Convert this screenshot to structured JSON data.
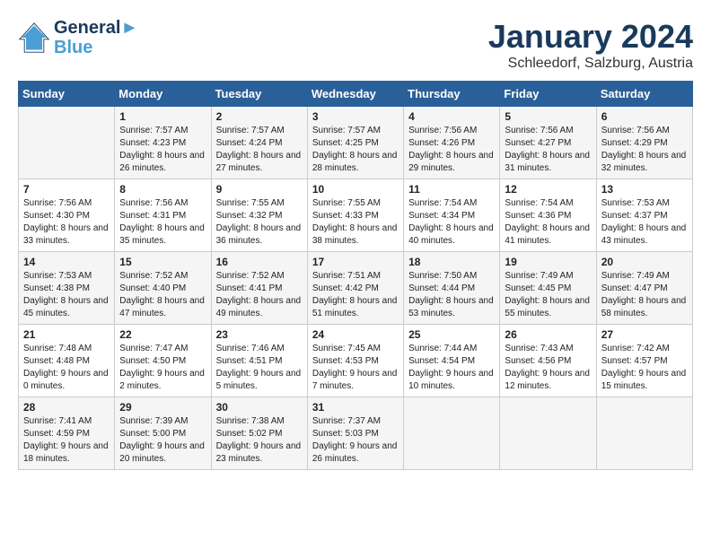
{
  "header": {
    "logo_line1": "General",
    "logo_line2": "Blue",
    "title": "January 2024",
    "subtitle": "Schleedorf, Salzburg, Austria"
  },
  "days": [
    "Sunday",
    "Monday",
    "Tuesday",
    "Wednesday",
    "Thursday",
    "Friday",
    "Saturday"
  ],
  "weeks": [
    [
      {
        "date": "",
        "sunrise": "",
        "sunset": "",
        "daylight": ""
      },
      {
        "date": "1",
        "sunrise": "Sunrise: 7:57 AM",
        "sunset": "Sunset: 4:23 PM",
        "daylight": "Daylight: 8 hours and 26 minutes."
      },
      {
        "date": "2",
        "sunrise": "Sunrise: 7:57 AM",
        "sunset": "Sunset: 4:24 PM",
        "daylight": "Daylight: 8 hours and 27 minutes."
      },
      {
        "date": "3",
        "sunrise": "Sunrise: 7:57 AM",
        "sunset": "Sunset: 4:25 PM",
        "daylight": "Daylight: 8 hours and 28 minutes."
      },
      {
        "date": "4",
        "sunrise": "Sunrise: 7:56 AM",
        "sunset": "Sunset: 4:26 PM",
        "daylight": "Daylight: 8 hours and 29 minutes."
      },
      {
        "date": "5",
        "sunrise": "Sunrise: 7:56 AM",
        "sunset": "Sunset: 4:27 PM",
        "daylight": "Daylight: 8 hours and 31 minutes."
      },
      {
        "date": "6",
        "sunrise": "Sunrise: 7:56 AM",
        "sunset": "Sunset: 4:29 PM",
        "daylight": "Daylight: 8 hours and 32 minutes."
      }
    ],
    [
      {
        "date": "7",
        "sunrise": "Sunrise: 7:56 AM",
        "sunset": "Sunset: 4:30 PM",
        "daylight": "Daylight: 8 hours and 33 minutes."
      },
      {
        "date": "8",
        "sunrise": "Sunrise: 7:56 AM",
        "sunset": "Sunset: 4:31 PM",
        "daylight": "Daylight: 8 hours and 35 minutes."
      },
      {
        "date": "9",
        "sunrise": "Sunrise: 7:55 AM",
        "sunset": "Sunset: 4:32 PM",
        "daylight": "Daylight: 8 hours and 36 minutes."
      },
      {
        "date": "10",
        "sunrise": "Sunrise: 7:55 AM",
        "sunset": "Sunset: 4:33 PM",
        "daylight": "Daylight: 8 hours and 38 minutes."
      },
      {
        "date": "11",
        "sunrise": "Sunrise: 7:54 AM",
        "sunset": "Sunset: 4:34 PM",
        "daylight": "Daylight: 8 hours and 40 minutes."
      },
      {
        "date": "12",
        "sunrise": "Sunrise: 7:54 AM",
        "sunset": "Sunset: 4:36 PM",
        "daylight": "Daylight: 8 hours and 41 minutes."
      },
      {
        "date": "13",
        "sunrise": "Sunrise: 7:53 AM",
        "sunset": "Sunset: 4:37 PM",
        "daylight": "Daylight: 8 hours and 43 minutes."
      }
    ],
    [
      {
        "date": "14",
        "sunrise": "Sunrise: 7:53 AM",
        "sunset": "Sunset: 4:38 PM",
        "daylight": "Daylight: 8 hours and 45 minutes."
      },
      {
        "date": "15",
        "sunrise": "Sunrise: 7:52 AM",
        "sunset": "Sunset: 4:40 PM",
        "daylight": "Daylight: 8 hours and 47 minutes."
      },
      {
        "date": "16",
        "sunrise": "Sunrise: 7:52 AM",
        "sunset": "Sunset: 4:41 PM",
        "daylight": "Daylight: 8 hours and 49 minutes."
      },
      {
        "date": "17",
        "sunrise": "Sunrise: 7:51 AM",
        "sunset": "Sunset: 4:42 PM",
        "daylight": "Daylight: 8 hours and 51 minutes."
      },
      {
        "date": "18",
        "sunrise": "Sunrise: 7:50 AM",
        "sunset": "Sunset: 4:44 PM",
        "daylight": "Daylight: 8 hours and 53 minutes."
      },
      {
        "date": "19",
        "sunrise": "Sunrise: 7:49 AM",
        "sunset": "Sunset: 4:45 PM",
        "daylight": "Daylight: 8 hours and 55 minutes."
      },
      {
        "date": "20",
        "sunrise": "Sunrise: 7:49 AM",
        "sunset": "Sunset: 4:47 PM",
        "daylight": "Daylight: 8 hours and 58 minutes."
      }
    ],
    [
      {
        "date": "21",
        "sunrise": "Sunrise: 7:48 AM",
        "sunset": "Sunset: 4:48 PM",
        "daylight": "Daylight: 9 hours and 0 minutes."
      },
      {
        "date": "22",
        "sunrise": "Sunrise: 7:47 AM",
        "sunset": "Sunset: 4:50 PM",
        "daylight": "Daylight: 9 hours and 2 minutes."
      },
      {
        "date": "23",
        "sunrise": "Sunrise: 7:46 AM",
        "sunset": "Sunset: 4:51 PM",
        "daylight": "Daylight: 9 hours and 5 minutes."
      },
      {
        "date": "24",
        "sunrise": "Sunrise: 7:45 AM",
        "sunset": "Sunset: 4:53 PM",
        "daylight": "Daylight: 9 hours and 7 minutes."
      },
      {
        "date": "25",
        "sunrise": "Sunrise: 7:44 AM",
        "sunset": "Sunset: 4:54 PM",
        "daylight": "Daylight: 9 hours and 10 minutes."
      },
      {
        "date": "26",
        "sunrise": "Sunrise: 7:43 AM",
        "sunset": "Sunset: 4:56 PM",
        "daylight": "Daylight: 9 hours and 12 minutes."
      },
      {
        "date": "27",
        "sunrise": "Sunrise: 7:42 AM",
        "sunset": "Sunset: 4:57 PM",
        "daylight": "Daylight: 9 hours and 15 minutes."
      }
    ],
    [
      {
        "date": "28",
        "sunrise": "Sunrise: 7:41 AM",
        "sunset": "Sunset: 4:59 PM",
        "daylight": "Daylight: 9 hours and 18 minutes."
      },
      {
        "date": "29",
        "sunrise": "Sunrise: 7:39 AM",
        "sunset": "Sunset: 5:00 PM",
        "daylight": "Daylight: 9 hours and 20 minutes."
      },
      {
        "date": "30",
        "sunrise": "Sunrise: 7:38 AM",
        "sunset": "Sunset: 5:02 PM",
        "daylight": "Daylight: 9 hours and 23 minutes."
      },
      {
        "date": "31",
        "sunrise": "Sunrise: 7:37 AM",
        "sunset": "Sunset: 5:03 PM",
        "daylight": "Daylight: 9 hours and 26 minutes."
      },
      {
        "date": "",
        "sunrise": "",
        "sunset": "",
        "daylight": ""
      },
      {
        "date": "",
        "sunrise": "",
        "sunset": "",
        "daylight": ""
      },
      {
        "date": "",
        "sunrise": "",
        "sunset": "",
        "daylight": ""
      }
    ]
  ]
}
